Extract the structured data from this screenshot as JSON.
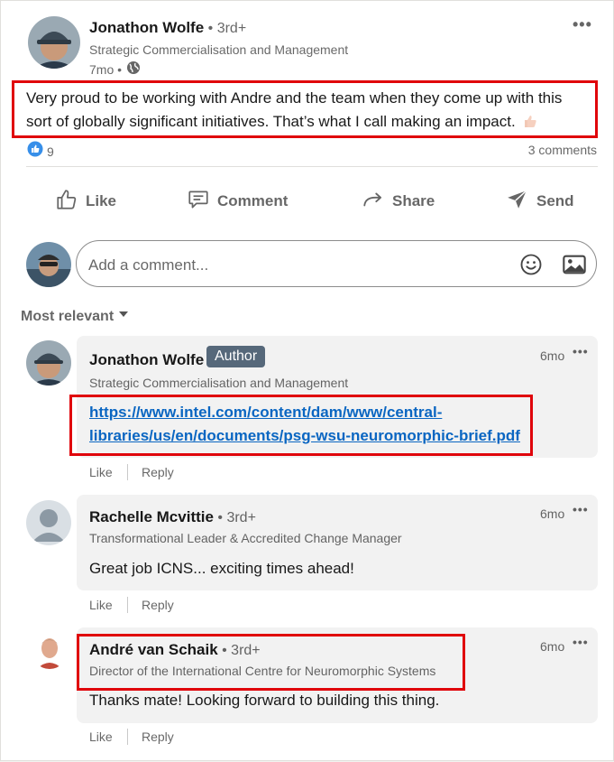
{
  "post": {
    "author_name": "Jonathon Wolfe",
    "author_degree": "• 3rd+",
    "author_headline": "Strategic Commercialisation and Management",
    "time": "7mo •",
    "text_line1": "Very proud to be working with Andre and the team when they come up with this",
    "text_line2": "sort of globally significant initiatives. That’s what I call making an impact.",
    "reaction_count": "9",
    "comments_count": "3 comments",
    "more_label": "•••"
  },
  "actions": {
    "like": "Like",
    "comment": "Comment",
    "share": "Share",
    "send": "Send"
  },
  "composer": {
    "placeholder": "Add a comment..."
  },
  "sort": {
    "label": "Most relevant"
  },
  "comments": [
    {
      "name": "Jonathon Wolfe",
      "badge": "Author",
      "headline": "Strategic Commercialisation and Management",
      "time": "6mo",
      "link_line1": "https://www.intel.com/content/dam/www/central-",
      "link_line2": "libraries/us/en/documents/psg-wsu-neuromorphic-brief.pdf",
      "like": "Like",
      "reply": "Reply"
    },
    {
      "name": "Rachelle Mcvittie",
      "degree": "• 3rd+",
      "headline": "Transformational Leader & Accredited Change Manager",
      "time": "6mo",
      "text": "Great job ICNS... exciting times ahead!",
      "like": "Like",
      "reply": "Reply"
    },
    {
      "name": "André van Schaik",
      "degree": "• 3rd+",
      "headline": "Director of the International Centre for Neuromorphic Systems",
      "time": "6mo",
      "text": "Thanks mate! Looking forward to building this thing.",
      "like": "Like",
      "reply": "Reply"
    }
  ],
  "colors": {
    "highlight": "#e0040b",
    "link": "#0a66c2",
    "like_reaction": "#378fe9"
  }
}
